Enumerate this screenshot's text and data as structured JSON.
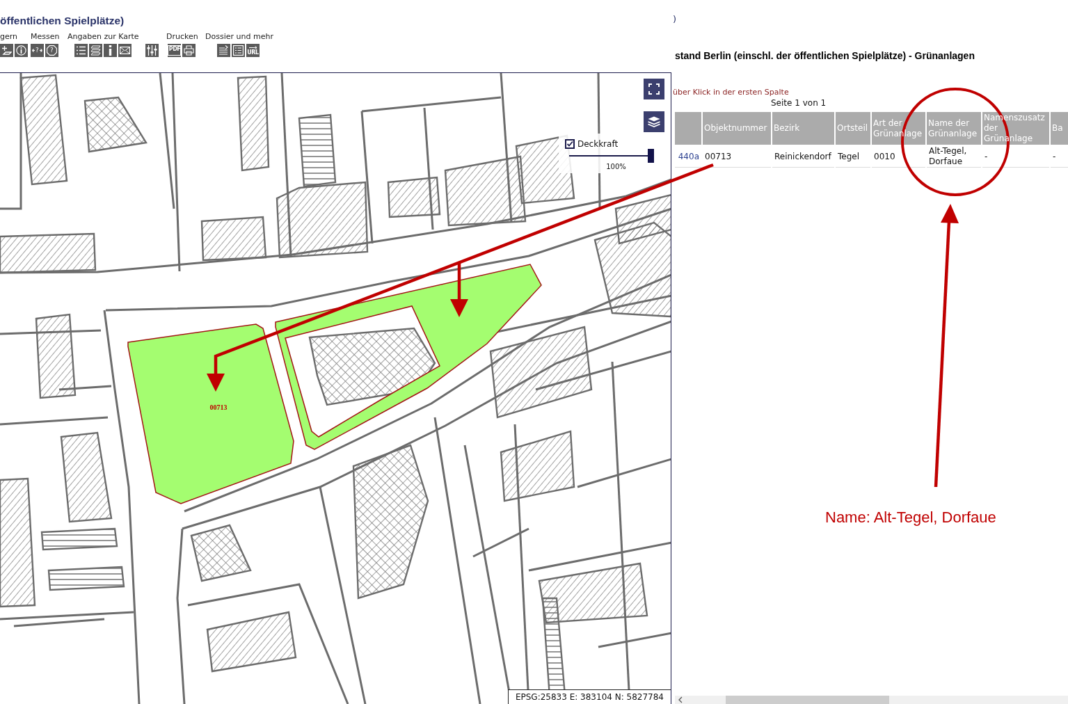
{
  "left_panel": {
    "title": "öffentlichen Spielplätze)",
    "toolbar": [
      {
        "label": "gern",
        "tools": [
          {
            "kind": "plus"
          },
          {
            "kind": "info"
          }
        ]
      },
      {
        "label": "Messen",
        "tools": [
          {
            "kind": "distance",
            "text": "?"
          },
          {
            "kind": "area",
            "text": "?"
          }
        ]
      },
      {
        "label": "Angaben zur Karte",
        "tools": [
          {
            "kind": "legend"
          },
          {
            "kind": "layers"
          },
          {
            "kind": "details"
          },
          {
            "kind": "mail"
          }
        ]
      },
      {
        "tools": [
          {
            "kind": "sliders"
          }
        ]
      },
      {
        "label": "Drucken",
        "tools": [
          {
            "kind": "document",
            "text": "PDF"
          },
          {
            "kind": "printer"
          }
        ]
      },
      {
        "label": "Dossier und mehr",
        "tools": [
          {
            "kind": "export"
          },
          {
            "kind": "report"
          },
          {
            "kind": "link",
            "text": "URL"
          }
        ]
      }
    ]
  },
  "map": {
    "opacity_control": {
      "label": "Deckkraft",
      "checked": true,
      "level": 1,
      "reading": "100%"
    },
    "feature_label": "00713",
    "coordinates": "EPSG:25833 E: 383104 N: 5827784"
  },
  "right_panel": {
    "title_fragment": ")",
    "layer_title": "stand Berlin (einschl. der öffentlichen Spielplätze) - Grünanlagen",
    "hint": "über Klick in der ersten Spalte",
    "pager": "Seite 1 von 1",
    "table": {
      "columns": [
        "Objektnummer",
        "Bezirk",
        "Ortsteil",
        "Art der Grünanlage",
        "Name der Grünanlage",
        "Namenszusatz der Grünanlage",
        "Ba"
      ],
      "rows": [
        {
          "link": "440a",
          "cells": [
            "00713",
            "Reinickendorf",
            "Tegel",
            "0010",
            "Alt-Tegel, Dorfaue",
            "-",
            "-"
          ]
        }
      ]
    }
  },
  "annotation": {
    "text": "Name: Alt-Tegel, Dorfaue"
  }
}
